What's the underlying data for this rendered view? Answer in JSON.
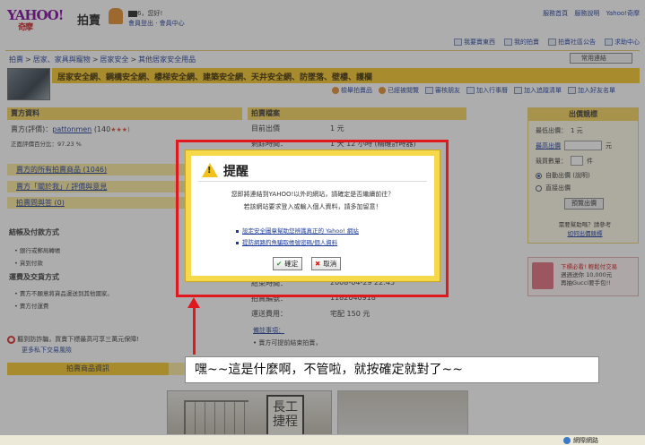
{
  "header": {
    "logo_text": "YAHOO!",
    "logo_sub": "奇摩",
    "title": "拍賣",
    "greeting_suffix": "6，您好!",
    "account_links": "會員登出 · 會員中心",
    "top_links": [
      "服務首頁",
      "服務說明",
      "Yahoo!奇摩"
    ]
  },
  "tools": [
    "我要賣東西",
    "我的拍賣",
    "拍賣社區公告",
    "求助中心"
  ],
  "breadcrumb": [
    "拍賣",
    "居家、家具與寵物",
    "居家安全",
    "其他居家安全用品"
  ],
  "quick_link": "常用連結",
  "category_text": "居家安全網、鋼構安全網、樓梯安全網、建築安全網、天井安全網、防墜落、壁樓、護欄",
  "actions": [
    "檢舉拍賣品",
    "已經被閱覽",
    "審核朋友",
    "加入行事曆",
    "加入追蹤清單",
    "加入好友名單"
  ],
  "seller": {
    "head": "賣方資料",
    "label": "賣方(評價)：",
    "name": "pattonmen",
    "rating": "(140",
    "stars": "★★★)",
    "score_line": "正面評價百分比：97.23 %",
    "links": [
      "賣方的所有拍賣商品 (1046)",
      "賣方「關於我」/ 評價與意見",
      "拍賣問與答 (0)"
    ]
  },
  "payment": {
    "title": "結帳及付款方式",
    "items": [
      "• 銀行或郵局轉帳",
      "• 貨到付款"
    ]
  },
  "shipping": {
    "title": "運費及交貨方式",
    "items": [
      "• 賣方不願意將貨品運送到其他國家。",
      "• 賣方付運費"
    ]
  },
  "fraud_note": "聽到防詐騙，買賣下標最高可享三萬元保障!",
  "trade_link": "更多私下交易風險",
  "auction": {
    "head": "拍賣檔案",
    "start_label": "目前出價",
    "start_value": "1 元",
    "remain_label": "剩餘時間：",
    "remain_value": "1 天 12 小時 (精確計時器)",
    "end_label": "結束時間：",
    "end_value": "2008-04-29 22:45",
    "id_label": "拍賣編號：",
    "id_value": "1182040918",
    "ship_label": "運送費用：",
    "ship_value": "宅配 150 元",
    "notes_title": "備註事項：",
    "notes_1": "• 賣方可提前結束拍賣，"
  },
  "bid": {
    "head": "出價競標",
    "min_label": "最低出價：",
    "min_value": "1 元",
    "max_label": "最高出價",
    "max_unit": "元",
    "qty_label": "競買數量：",
    "qty_unit": "件",
    "auto_label": "自動出價 (說明)",
    "direct_label": "直接出價",
    "preview_btn": "預覽出價",
    "help_1": "需要幫助嗎？請參考",
    "help_2": "如何出價競標"
  },
  "promo": {
    "line1": "下標必看! 輕鬆付交易",
    "line2": "週週送你 10,000元",
    "line3": "再抽Gucci要手包!!"
  },
  "tab_active": "拍賣商品資訊",
  "photo_sign": "長工\n捷程",
  "status": {
    "zone": "網際網路"
  },
  "dialog": {
    "title": "提醒",
    "msg1": "您即將連結到YAHOO!以外的網站，請確定是否繼續前往？",
    "msg2": "若該網站要求登入或輸入個人資料，請多加留意！",
    "bullet1": "設定安全圖章幫助您辨識真正的 Yahoo! 網站",
    "bullet2": "提防網路釣魚騙取帳號密碼/個人資料",
    "ok": "確定",
    "cancel": "取消"
  },
  "caption": "嘿~~這是什麼啊，不管啦，就按確定就對了~~",
  "colors": {
    "highlight_red": "#e2181f",
    "dialog_border": "#f6d94a",
    "category_band": "#f5c523"
  }
}
